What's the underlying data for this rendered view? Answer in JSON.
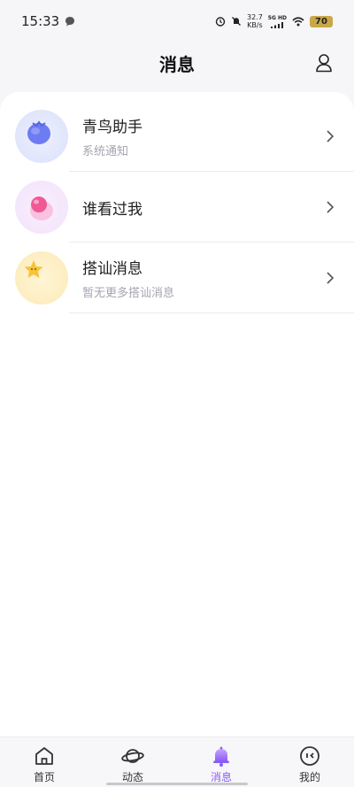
{
  "status_bar": {
    "time": "15:33",
    "net_speed_value": "32.7",
    "net_speed_unit": "KB/s",
    "network": "5G HD",
    "battery": "70"
  },
  "header": {
    "title": "消息"
  },
  "messages": [
    {
      "title": "青鸟助手",
      "subtitle": "系统通知",
      "icon": "bluebird-icon"
    },
    {
      "title": "谁看过我",
      "subtitle": "",
      "icon": "pink-ghost-icon"
    },
    {
      "title": "搭讪消息",
      "subtitle": "暂无更多搭讪消息",
      "icon": "star-icon"
    }
  ],
  "tabs": [
    {
      "label": "首页",
      "icon": "home-icon"
    },
    {
      "label": "动态",
      "icon": "planet-icon"
    },
    {
      "label": "消息",
      "icon": "bell-icon",
      "active": true
    },
    {
      "label": "我的",
      "icon": "face-icon"
    }
  ],
  "colors": {
    "accent": "#8b5cf6"
  }
}
